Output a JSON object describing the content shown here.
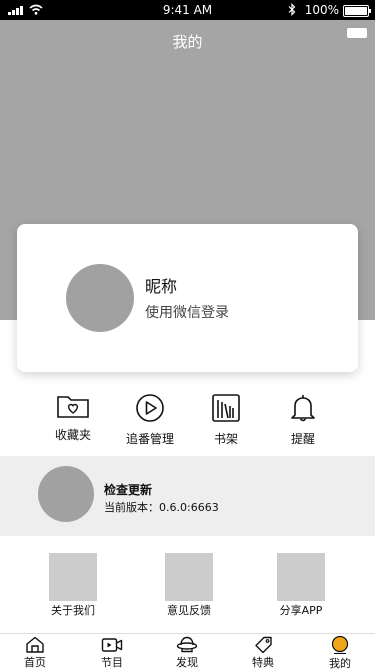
{
  "status_bar": {
    "time": "9:41 AM",
    "battery": "100%"
  },
  "header": {
    "title": "我的"
  },
  "profile": {
    "nickname": "昵称",
    "login_text": "使用微信登录"
  },
  "quick_actions": [
    {
      "label": "收藏夹",
      "icon": "favorites-folder-icon"
    },
    {
      "label": "追番管理",
      "icon": "play-circle-icon"
    },
    {
      "label": "书架",
      "icon": "bookshelf-icon"
    },
    {
      "label": "提醒",
      "icon": "bell-icon"
    }
  ],
  "update": {
    "title": "检查更新",
    "version": "当前版本：0.6.0:6663"
  },
  "tiles": [
    {
      "label": "关于我们"
    },
    {
      "label": "意见反馈"
    },
    {
      "label": "分享APP"
    }
  ],
  "tabs": [
    {
      "label": "首页",
      "icon": "home-icon"
    },
    {
      "label": "节目",
      "icon": "video-icon"
    },
    {
      "label": "发现",
      "icon": "discover-icon"
    },
    {
      "label": "特典",
      "icon": "tag-icon"
    },
    {
      "label": "我的",
      "icon": "profile-icon",
      "active": true
    }
  ],
  "colors": {
    "accent": "#f0a51a",
    "header_bg": "#a5a5a5",
    "band_bg": "#eeeeee"
  }
}
